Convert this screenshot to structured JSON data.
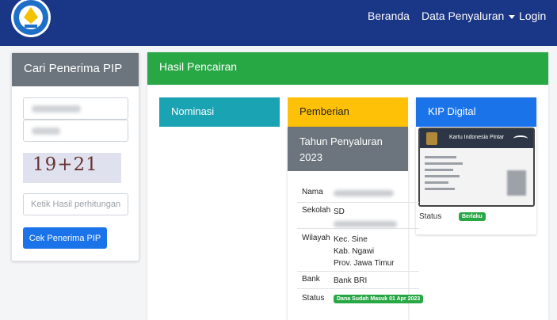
{
  "navbar": {
    "logo_text": "TUT WURI HANDAYANI",
    "links": [
      "Beranda",
      "Data Penyaluran",
      "Login"
    ]
  },
  "search": {
    "title": "Cari Penerima PIP",
    "captcha": "19+21",
    "result_placeholder": "Ketik Hasil perhitungan",
    "submit_label": "Cek Penerima PIP"
  },
  "hasil": {
    "title": "Hasil Pencairan",
    "nominasi_title": "Nominasi",
    "pemberian_title": "Pemberian",
    "tahun_title": "Tahun Penyaluran 2023",
    "rows": {
      "nama_label": "Nama",
      "sekolah_label": "Sekolah",
      "sekolah_prefix": "SD",
      "wilayah_label": "Wilayah",
      "wilayah_lines": [
        "Kec. Sine",
        "Kab. Ngawi",
        "Prov. Jawa Timur"
      ],
      "bank_label": "Bank",
      "bank_value": "Bank BRI",
      "status_label": "Status",
      "status_value": "Dana Sudah Masuk 01 Apr 2023"
    }
  },
  "kip": {
    "title": "KIP Digital",
    "card_title": "Kartu Indonesia Pintar",
    "status_label": "Status",
    "status_value": "Berlaku"
  },
  "colors": {
    "navbar": "#1a3686",
    "success": "#28a745",
    "info": "#1aa3b3",
    "warning": "#ffc107",
    "primary": "#1a73e8",
    "secondary": "#6c757d"
  }
}
